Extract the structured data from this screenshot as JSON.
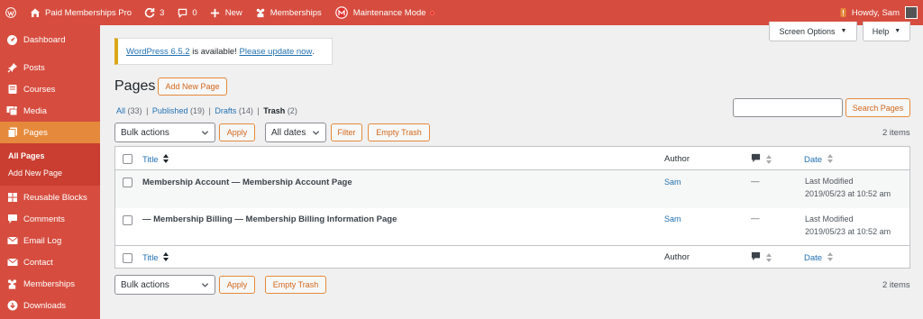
{
  "admin_bar": {
    "site_name": "Paid Memberships Pro",
    "updates_count": "3",
    "comments_count": "0",
    "new_label": "New",
    "memberships_label": "Memberships",
    "maintenance_label": "Maintenance Mode",
    "howdy": "Howdy, Sam"
  },
  "sidebar": {
    "items": [
      {
        "label": "Dashboard",
        "icon": "dashboard-icon"
      },
      {
        "label": "Posts",
        "icon": "pin-icon"
      },
      {
        "label": "Courses",
        "icon": "book-icon"
      },
      {
        "label": "Media",
        "icon": "media-icon"
      },
      {
        "label": "Pages",
        "icon": "page-icon"
      },
      {
        "label": "Reusable Blocks",
        "icon": "blocks-icon"
      },
      {
        "label": "Comments",
        "icon": "comment-icon"
      },
      {
        "label": "Email Log",
        "icon": "email-icon"
      },
      {
        "label": "Contact",
        "icon": "mail-icon"
      },
      {
        "label": "Memberships",
        "icon": "members-icon"
      },
      {
        "label": "Downloads",
        "icon": "download-icon"
      }
    ],
    "submenu": [
      "All Pages",
      "Add New Page"
    ]
  },
  "screen_options": "Screen Options",
  "help": "Help",
  "notice": {
    "version_link": "WordPress 6.5.2",
    "middle": " is available! ",
    "update_link": "Please update now",
    "end": "."
  },
  "page_title": "Pages",
  "add_new_page": "Add New Page",
  "filters": {
    "all": "All",
    "all_count": "(33)",
    "published": "Published",
    "published_count": "(19)",
    "drafts": "Drafts",
    "drafts_count": "(14)",
    "trash": "Trash",
    "trash_count": "(2)",
    "sep": "|"
  },
  "search_button": "Search Pages",
  "bulk_actions": "Bulk actions",
  "apply": "Apply",
  "all_dates": "All dates",
  "filter": "Filter",
  "empty_trash": "Empty Trash",
  "items_count": "2 items",
  "table": {
    "columns": {
      "title": "Title",
      "author": "Author",
      "date": "Date"
    },
    "rows": [
      {
        "title": "Membership Account — Membership Account Page",
        "author": "Sam",
        "comments": "—",
        "date_status": "Last Modified",
        "date": "2019/05/23 at 10:52 am"
      },
      {
        "title": "— Membership Billing — Membership Billing Information Page",
        "author": "Sam",
        "comments": "—",
        "date_status": "Last Modified",
        "date": "2019/05/23 at 10:52 am"
      }
    ]
  },
  "colors": {
    "accent": "#d64d3f",
    "current": "#e58a3c",
    "link": "#2271b1"
  }
}
